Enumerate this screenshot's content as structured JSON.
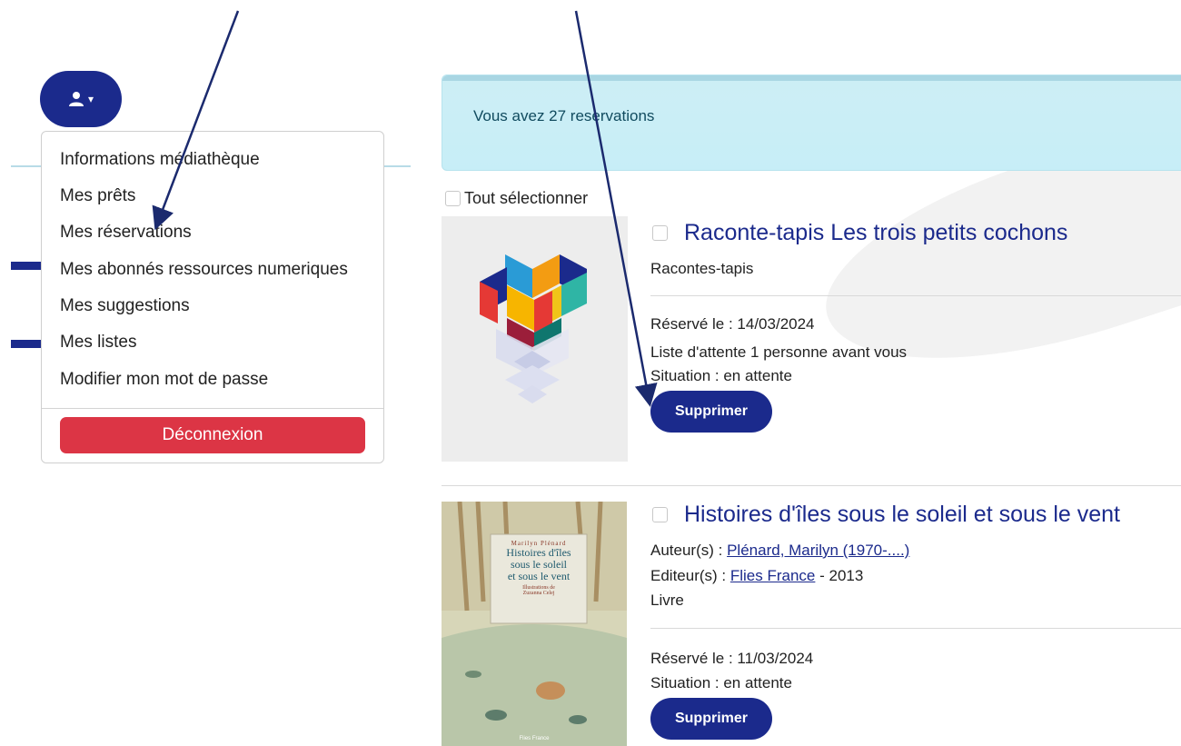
{
  "menu": {
    "items": [
      "Informations médiathèque",
      "Mes prêts",
      "Mes réservations",
      "Mes abonnés ressources numeriques",
      "Mes suggestions",
      "Mes listes",
      "Modifier mon mot de passe"
    ],
    "logout_label": "Déconnexion"
  },
  "banner": {
    "text": "Vous avez 27 reservations"
  },
  "select_all_label": "Tout sélectionner",
  "reservations": [
    {
      "title": "Raconte-tapis Les trois petits cochons",
      "type": "Racontes-tapis",
      "reserved_on": "Réservé le : 14/03/2024",
      "queue": "Liste d'attente 1 personne avant vous",
      "status": "Situation : en attente",
      "delete_label": "Supprimer"
    },
    {
      "title": "Histoires d'îles sous le soleil et sous le vent",
      "authors_label": "Auteur(s) : ",
      "author": "Plénard, Marilyn (1970-....)",
      "publisher_label": "Editeur(s) : ",
      "publisher": "Flies France",
      "year_suffix": " - 2013",
      "type": "Livre",
      "reserved_on": "Réservé le : 11/03/2024",
      "status": "Situation : en attente",
      "delete_label": "Supprimer",
      "cover": {
        "author_line": "Marilyn Plénard",
        "title_lines": [
          "Histoires d'îles",
          "sous le soleil",
          "et sous le vent"
        ],
        "illustrator_line1": "Illustrations de",
        "illustrator_line2": "Zuzanna Celej",
        "publisher": "Flies France"
      }
    }
  ],
  "colors": {
    "primary": "#1b2a8c",
    "danger": "#dc3545",
    "banner_bg": "#c9eef6",
    "banner_text": "#114b5f"
  },
  "icons": [
    "user-icon",
    "caret-down-icon"
  ]
}
